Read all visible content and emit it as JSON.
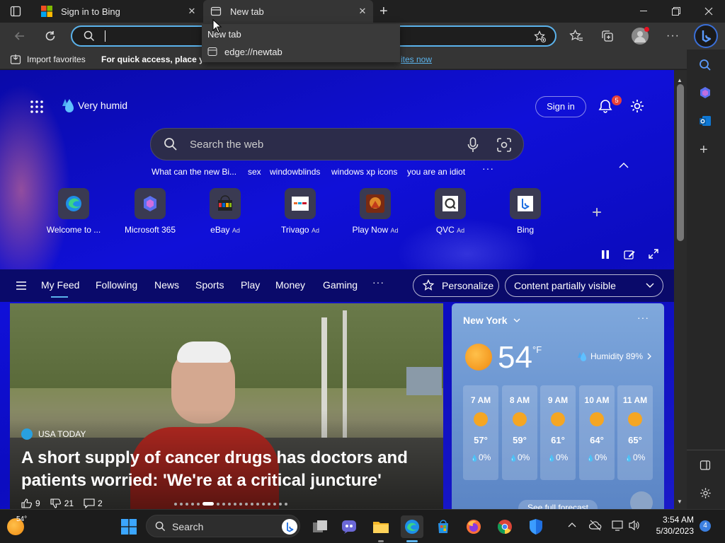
{
  "browser": {
    "tabs": [
      {
        "title": "Sign in to Bing"
      },
      {
        "title": "New tab"
      }
    ],
    "omnibox_value": "",
    "dropdown": {
      "header": "New tab",
      "suggestion": "edge://newtab"
    },
    "favorites_bar": {
      "import_label": "Import favorites",
      "message_bold": "For quick access, place you",
      "link": "ites now"
    }
  },
  "newtab": {
    "weather_badge": "Very humid",
    "sign_in": "Sign in",
    "notification_count": "5",
    "search_placeholder": "Search the web",
    "trending": [
      "What can the new Bi...",
      "sex",
      "windowblinds",
      "windows xp icons",
      "you are an idiot"
    ],
    "quick_links": [
      {
        "label": "Welcome to ...",
        "ad": "",
        "icon": "edge-icon"
      },
      {
        "label": "Microsoft 365",
        "ad": "",
        "icon": "m365-icon"
      },
      {
        "label": "eBay",
        "ad": "Ad",
        "icon": "ebay-icon"
      },
      {
        "label": "Trivago",
        "ad": "Ad",
        "icon": "trivago-icon"
      },
      {
        "label": "Play Now",
        "ad": "Ad",
        "icon": "game-icon"
      },
      {
        "label": "QVC",
        "ad": "Ad",
        "icon": "qvc-icon"
      },
      {
        "label": "Bing",
        "ad": "",
        "icon": "bing-icon"
      }
    ],
    "feed_nav": [
      "My Feed",
      "Following",
      "News",
      "Sports",
      "Play",
      "Money",
      "Gaming"
    ],
    "personalize": "Personalize",
    "content_visibility": "Content partially visible"
  },
  "hero": {
    "source": "USA TODAY",
    "headline_line1": "A short supply of cancer drugs has doctors and",
    "headline_line2": "patients worried: 'We're at a critical juncture'",
    "likes": "9",
    "dislikes": "21",
    "comments": "2"
  },
  "weather": {
    "city": "New York",
    "temp": "54",
    "unit": "°F",
    "humidity": "Humidity 89%",
    "hours": [
      {
        "time": "7 AM",
        "temp": "57°",
        "precip": "0%"
      },
      {
        "time": "8 AM",
        "temp": "59°",
        "precip": "0%"
      },
      {
        "time": "9 AM",
        "temp": "61°",
        "precip": "0%"
      },
      {
        "time": "10 AM",
        "temp": "64°",
        "precip": "0%"
      },
      {
        "time": "11 AM",
        "temp": "65°",
        "precip": "0%"
      }
    ],
    "forecast_link": "See full forecast"
  },
  "taskbar": {
    "weather_temp": "54°",
    "search_label": "Search",
    "time": "3:54 AM",
    "date": "5/30/2023",
    "notification_badge": "4"
  },
  "colors": {
    "accent": "#5bb3ec",
    "page_bg": "#0c0cc0",
    "taskbar": "#1c1c1c"
  }
}
